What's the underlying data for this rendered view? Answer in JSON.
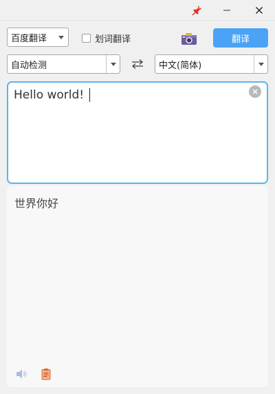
{
  "titlebar": {
    "pin_icon": "pin-icon",
    "minimize_icon": "minimize-icon",
    "close_icon": "close-icon"
  },
  "toolbar": {
    "engine": "百度翻译",
    "word_select_label": "划词翻译",
    "word_select_checked": false,
    "camera_icon": "camera-icon",
    "translate_label": "翻译"
  },
  "languages": {
    "source": "自动检测",
    "target": "中文(简体)",
    "swap_icon": "swap-arrows-icon"
  },
  "input": {
    "text": "Hello world!"
  },
  "output": {
    "text": "世界你好",
    "speaker_icon": "speaker-icon",
    "copy_icon": "clipboard-icon"
  },
  "colors": {
    "accent": "#4aa3f5",
    "focus_border": "#5cb4ec",
    "background": "#f0f0f0"
  }
}
